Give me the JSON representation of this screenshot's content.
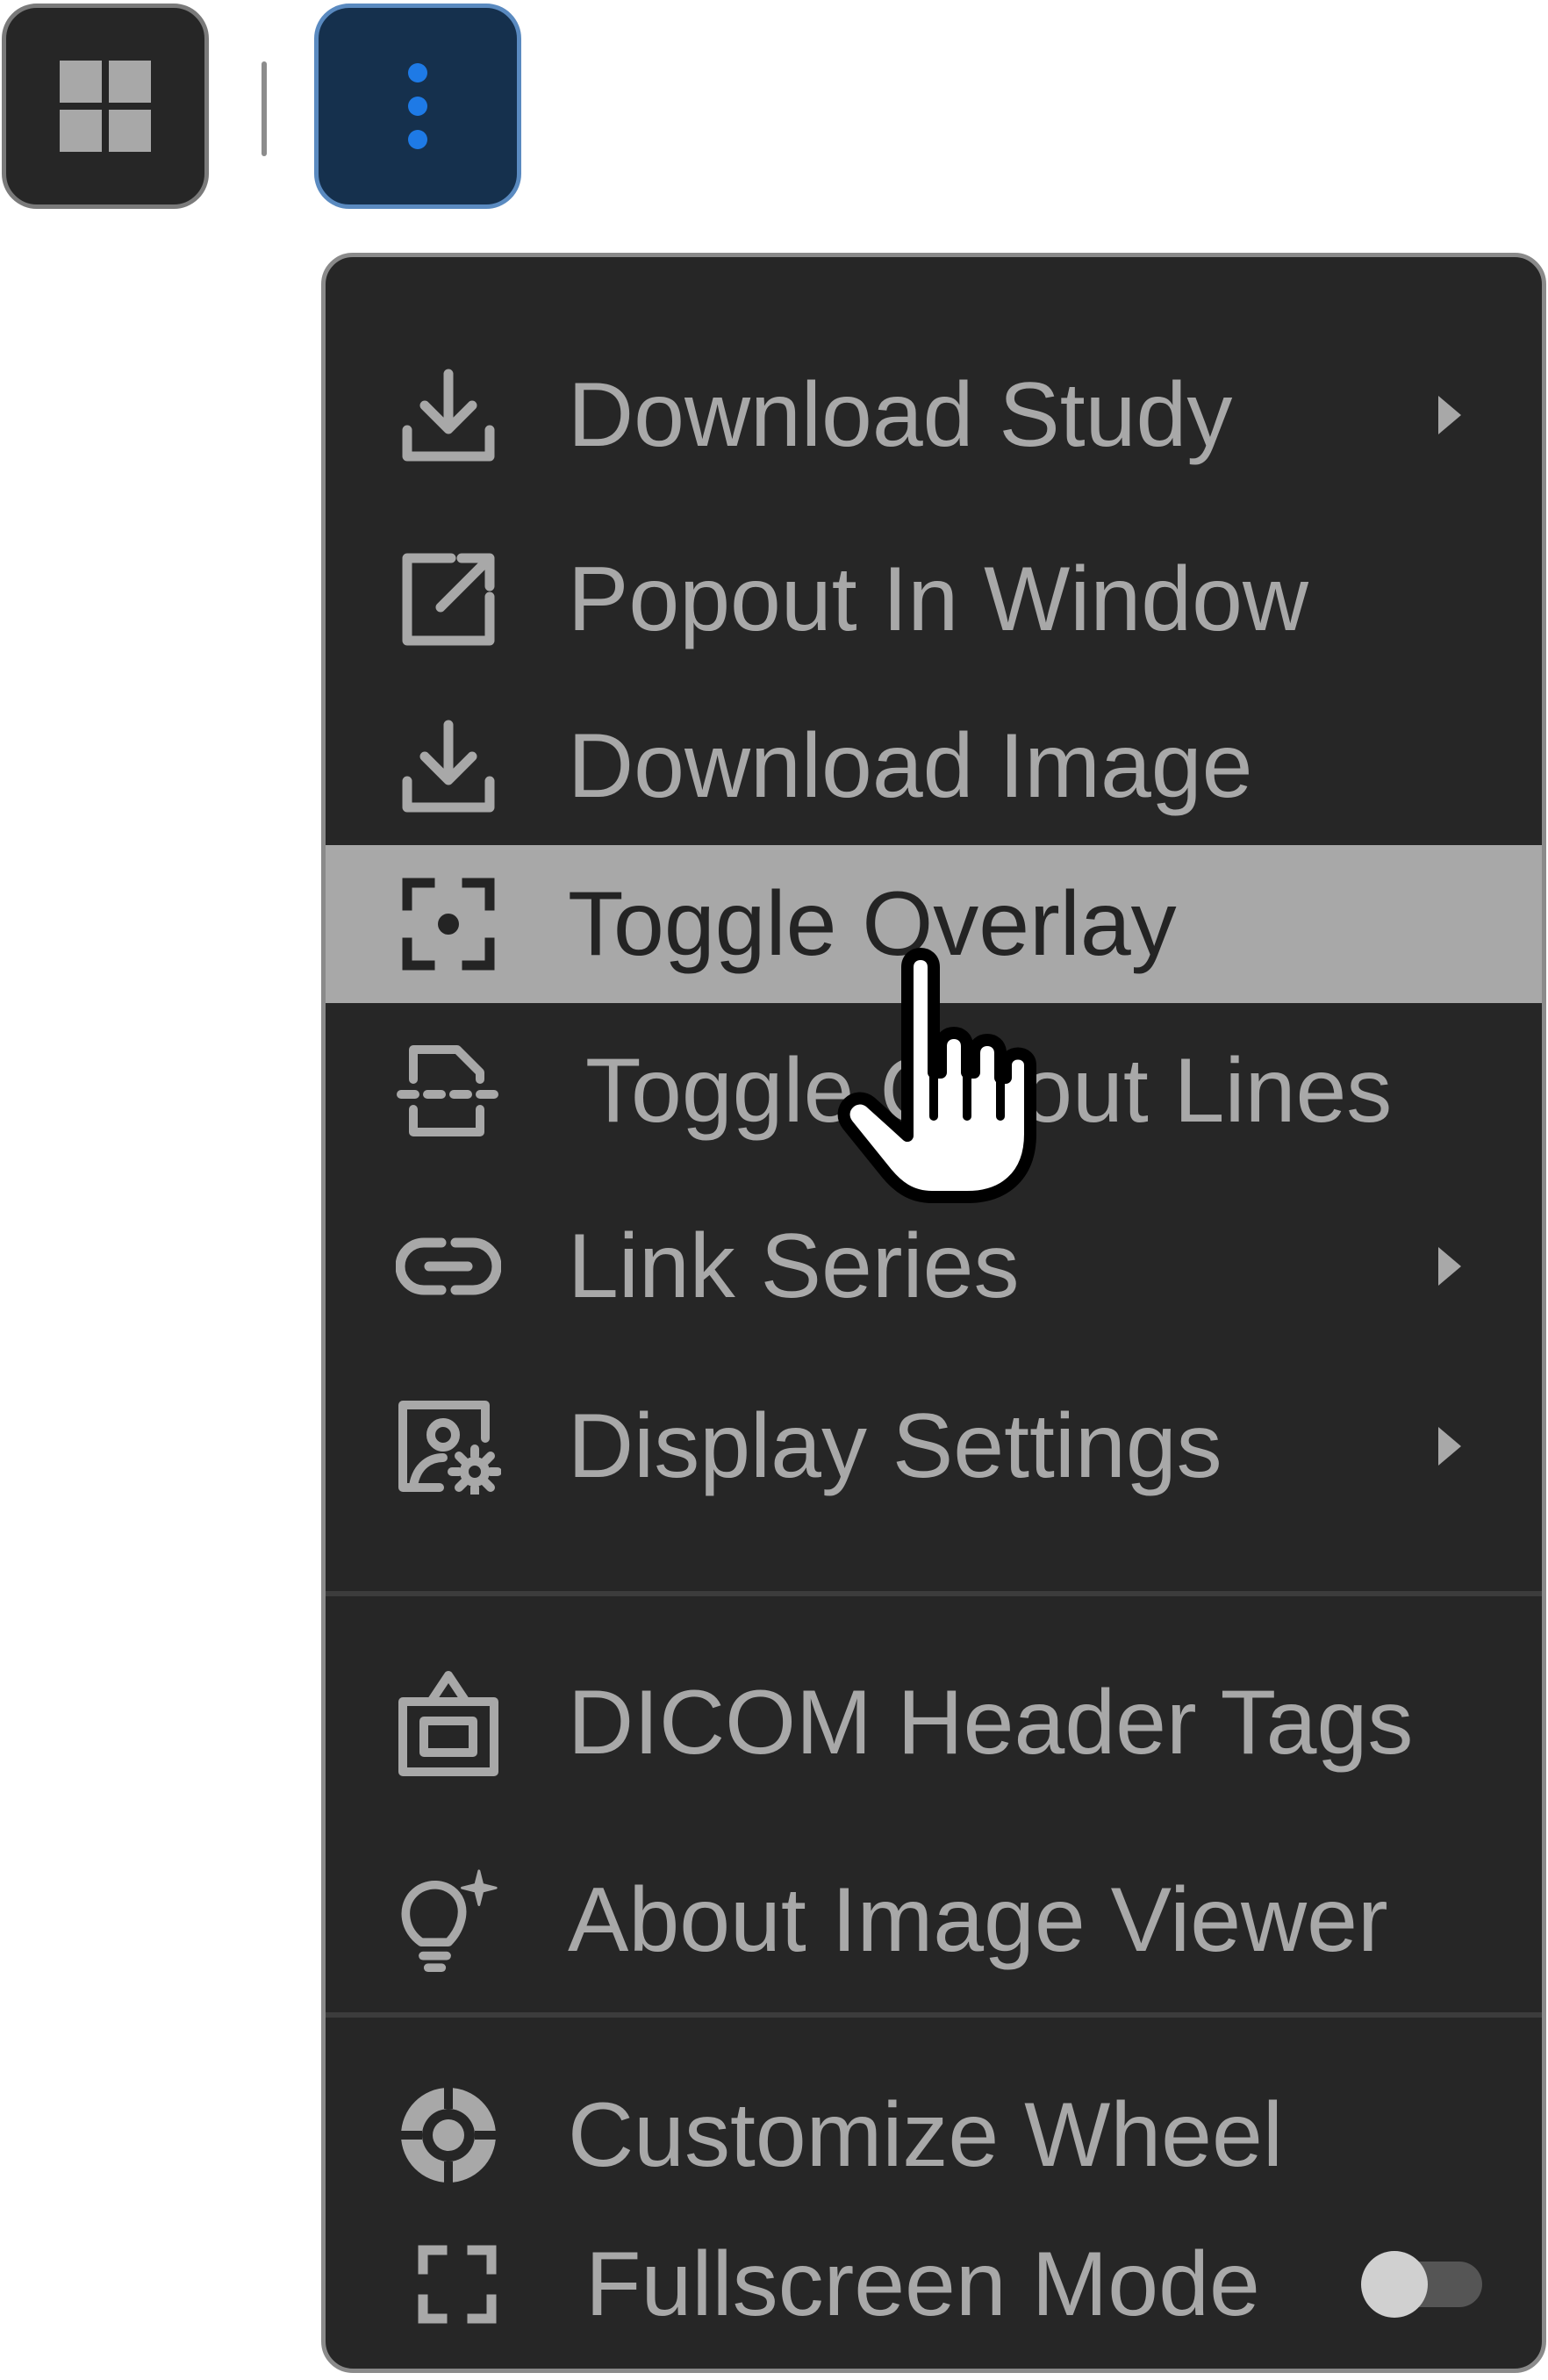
{
  "toolbar": {
    "layout_icon": "grid-layout-icon",
    "more_icon": "more-vertical-icon",
    "accent": "#1e7ae6"
  },
  "menu": {
    "items": [
      {
        "label": "Download Study",
        "icon": "download-icon",
        "submenu": true
      },
      {
        "label": "Popout In Window",
        "icon": "popout-icon",
        "submenu": false
      },
      {
        "label": "Download Image",
        "icon": "download-icon",
        "submenu": false
      },
      {
        "label": "Toggle Overlay",
        "icon": "overlay-focus-icon",
        "submenu": false,
        "highlighted": true
      },
      {
        "label": "Toggle Cutout Lines",
        "icon": "cutout-lines-icon",
        "submenu": false
      },
      {
        "label": "Link Series",
        "icon": "link-icon",
        "submenu": true
      },
      {
        "label": "Display Settings",
        "icon": "image-settings-icon",
        "submenu": true
      },
      {
        "label": "DICOM Header Tags",
        "icon": "header-tags-icon",
        "submenu": false
      },
      {
        "label": "About Image Viewer",
        "icon": "lightbulb-sparkle-icon",
        "submenu": false
      },
      {
        "label": "Customize Wheel",
        "icon": "wheel-icon",
        "submenu": false
      },
      {
        "label": "Fullscreen Mode",
        "icon": "fullscreen-icon",
        "toggle": true,
        "toggle_on": false
      }
    ],
    "highlight_color": "#a8a8a8",
    "background": "#262626"
  },
  "cursor": {
    "icon": "hand-pointer-icon"
  }
}
